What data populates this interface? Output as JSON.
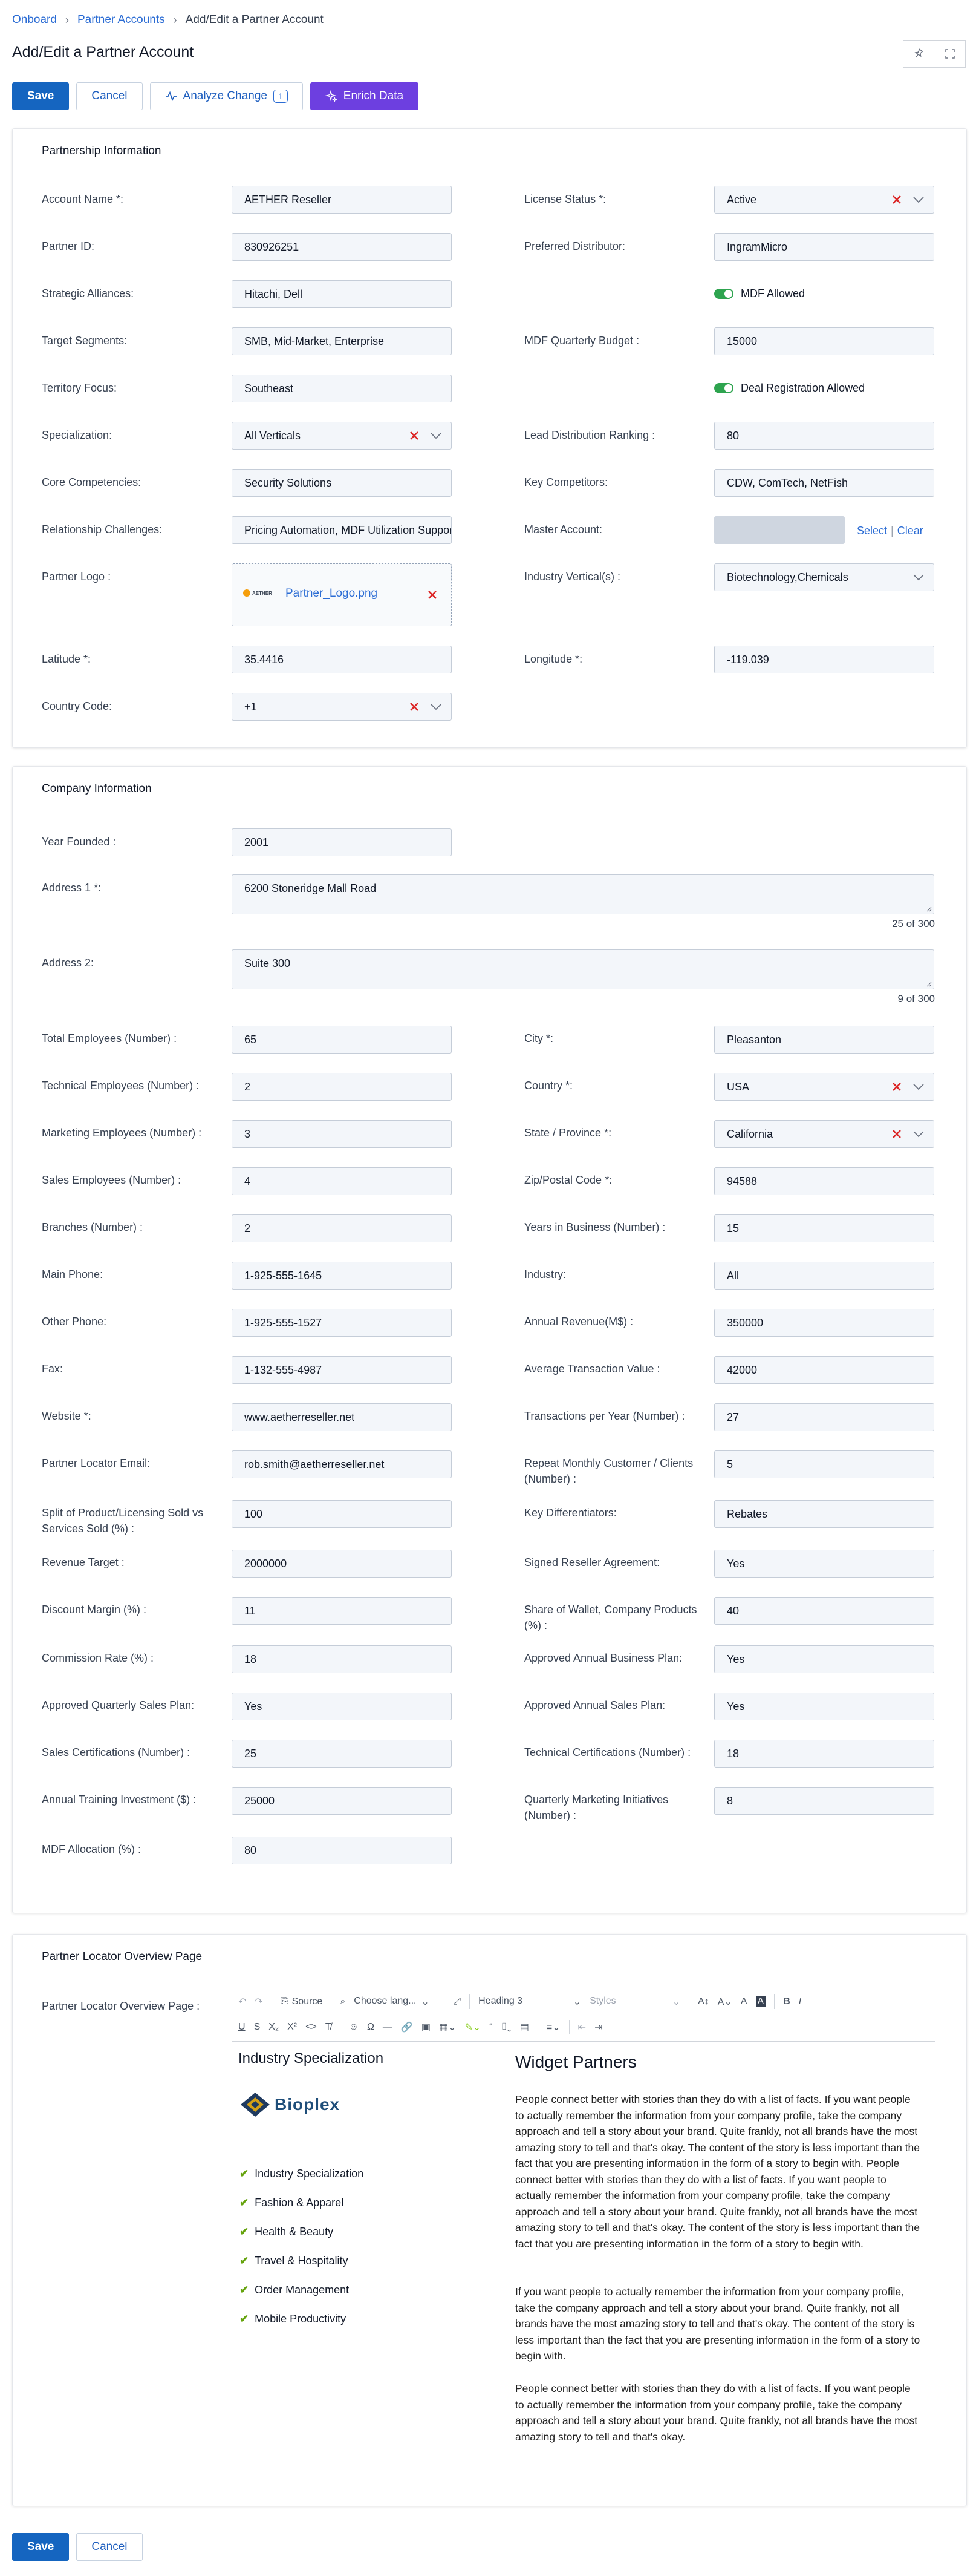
{
  "breadcrumb": {
    "items": [
      "Onboard",
      "Partner Accounts"
    ],
    "current": "Add/Edit a Partner Account"
  },
  "page_title": "Add/Edit a Partner Account",
  "toolbar": {
    "save": "Save",
    "cancel": "Cancel",
    "analyze": "Analyze Change",
    "analyze_count": "1",
    "enrich": "Enrich Data"
  },
  "partnership": {
    "title": "Partnership Information",
    "account_name_label": "Account Name *:",
    "account_name": "AETHER Reseller",
    "license_status_label": "License Status *:",
    "license_status": "Active",
    "partner_id_label": "Partner ID:",
    "partner_id": "830926251",
    "preferred_distributor_label": "Preferred Distributor:",
    "preferred_distributor": "IngramMicro",
    "strategic_alliances_label": "Strategic Alliances:",
    "strategic_alliances": "Hitachi, Dell",
    "mdf_allowed_label": "MDF Allowed",
    "target_segments_label": "Target Segments:",
    "target_segments": "SMB, Mid-Market, Enterprise",
    "mdf_budget_label": "MDF Quarterly Budget :",
    "mdf_budget": "15000",
    "territory_label": "Territory Focus:",
    "territory": "Southeast",
    "deal_reg_label": "Deal Registration Allowed",
    "specialization_label": "Specialization:",
    "specialization": "All Verticals",
    "lead_ranking_label": "Lead Distribution Ranking :",
    "lead_ranking": "80",
    "core_comp_label": "Core Competencies:",
    "core_comp": "Security Solutions",
    "key_competitors_label": "Key Competitors:",
    "key_competitors": "CDW, ComTech, NetFish",
    "rel_challenges_label": "Relationship Challenges:",
    "rel_challenges": "Pricing Automation, MDF Utilization Support",
    "master_account_label": "Master Account:",
    "master_select": "Select",
    "master_sep": "|",
    "master_clear": "Clear",
    "partner_logo_label": "Partner Logo :",
    "logo_thumb_text": "AETHER",
    "logo_file": "Partner_Logo.png",
    "industry_vertical_label": "Industry Vertical(s) :",
    "industry_vertical": "Biotechnology,Chemicals",
    "latitude_label": "Latitude  *:",
    "latitude": "35.4416",
    "longitude_label": "Longitude  *:",
    "longitude": "-119.039",
    "country_code_label": "Country Code:",
    "country_code": "+1"
  },
  "company": {
    "title": "Company Information",
    "year_founded_label": "Year Founded :",
    "year_founded": "2001",
    "address1_label": "Address 1 *:",
    "address1": "6200 Stoneridge Mall Road",
    "address1_count": "25 of 300",
    "address2_label": "Address 2:",
    "address2": "Suite 300",
    "address2_count": "9 of 300",
    "left": [
      {
        "label": "Total Employees (Number) :",
        "value": "65"
      },
      {
        "label": "Technical Employees (Number) :",
        "value": "2"
      },
      {
        "label": "Marketing Employees (Number) :",
        "value": "3"
      },
      {
        "label": "Sales Employees (Number) :",
        "value": "4"
      },
      {
        "label": "Branches (Number) :",
        "value": "2"
      },
      {
        "label": "Main Phone:",
        "value": "1-925-555-1645"
      },
      {
        "label": "Other Phone:",
        "value": "1-925-555-1527"
      },
      {
        "label": "Fax:",
        "value": "1-132-555-4987"
      },
      {
        "label": "Website *:",
        "value": "www.aetherreseller.net"
      },
      {
        "label": "Partner Locator Email:",
        "value": "rob.smith@aetherreseller.net"
      },
      {
        "label": "Split of Product/Licensing Sold vs Services Sold (%) :",
        "value": "100"
      },
      {
        "label": "Revenue Target :",
        "value": "2000000"
      },
      {
        "label": "Discount Margin (%) :",
        "value": "11"
      },
      {
        "label": "Commission Rate (%) :",
        "value": "18"
      },
      {
        "label": "Approved Quarterly Sales Plan:",
        "value": "Yes"
      },
      {
        "label": "Sales Certifications (Number) :",
        "value": "25"
      },
      {
        "label": "Annual Training Investment ($) :",
        "value": "25000"
      },
      {
        "label": "MDF Allocation (%) :",
        "value": "80"
      }
    ],
    "right": [
      {
        "label": "City *:",
        "value": "Pleasanton"
      },
      {
        "label": "Country *:",
        "value": "USA"
      },
      {
        "label": "State / Province *:",
        "value": "California"
      },
      {
        "label": "Zip/Postal Code *:",
        "value": "94588"
      },
      {
        "label": "Years in Business (Number) :",
        "value": "15"
      },
      {
        "label": "Industry:",
        "value": "All"
      },
      {
        "label": "Annual Revenue(M$) :",
        "value": "350000"
      },
      {
        "label": "Average Transaction Value :",
        "value": "42000"
      },
      {
        "label": "Transactions per Year (Number) :",
        "value": "27"
      },
      {
        "label": "Repeat Monthly Customer / Clients (Number) :",
        "value": "5"
      },
      {
        "label": "Key Differentiators:",
        "value": "Rebates"
      },
      {
        "label": "Signed Reseller Agreement:",
        "value": "Yes"
      },
      {
        "label": "Share of Wallet, Company Products (%) :",
        "value": "40"
      },
      {
        "label": "Approved Annual Business Plan:",
        "value": "Yes"
      },
      {
        "label": "Approved Annual Sales Plan:",
        "value": "Yes"
      },
      {
        "label": "Technical Certifications (Number) :",
        "value": "18"
      },
      {
        "label": "Quarterly Marketing Initiatives (Number) :",
        "value": "8"
      }
    ]
  },
  "locator": {
    "title": "Partner Locator Overview Page",
    "field_label": "Partner Locator Overview Page :",
    "toolbar": {
      "source": "Source",
      "language": "Choose lang...",
      "heading": "Heading 3",
      "styles": "Styles"
    },
    "left_heading": "Industry Specialization",
    "logo_text": "Bioplex",
    "items": [
      "Industry Specialization",
      "Fashion & Apparel",
      "Health & Beauty",
      "Travel & Hospitality",
      "Order Management",
      "Mobile Productivity"
    ],
    "right_heading": "Widget Partners",
    "paragraphs": [
      "People connect better with stories than they do with a list of facts. If you want people to actually remember the information from your company profile, take the company approach and tell a story about your brand. Quite frankly, not all brands have the most amazing story to tell and that's okay. The content of the story is less important than the fact that you are presenting information in the form of a story to begin with. People connect better with stories than they do with a list of facts. If you want people to actually remember the information from your company profile, take the company approach and tell a story about your brand. Quite frankly, not all brands have the most amazing story to tell and that's okay. The content of the story is less important than the fact that you are presenting information in the form of a story to begin with.",
      "If you want people to actually remember the information from your company profile, take the company approach and tell a story about your brand. Quite frankly, not all brands have the most amazing story to tell and that's okay. The content of the story is less important than the fact that you are presenting information in the form of a story to begin with.",
      "People connect better with stories than they do with a list of facts. If you want people to actually remember the information from your company profile, take the company approach and tell a story about your brand. Quite frankly, not all brands have the most amazing story to tell and that's okay."
    ]
  },
  "footer": {
    "save": "Save",
    "cancel": "Cancel"
  }
}
